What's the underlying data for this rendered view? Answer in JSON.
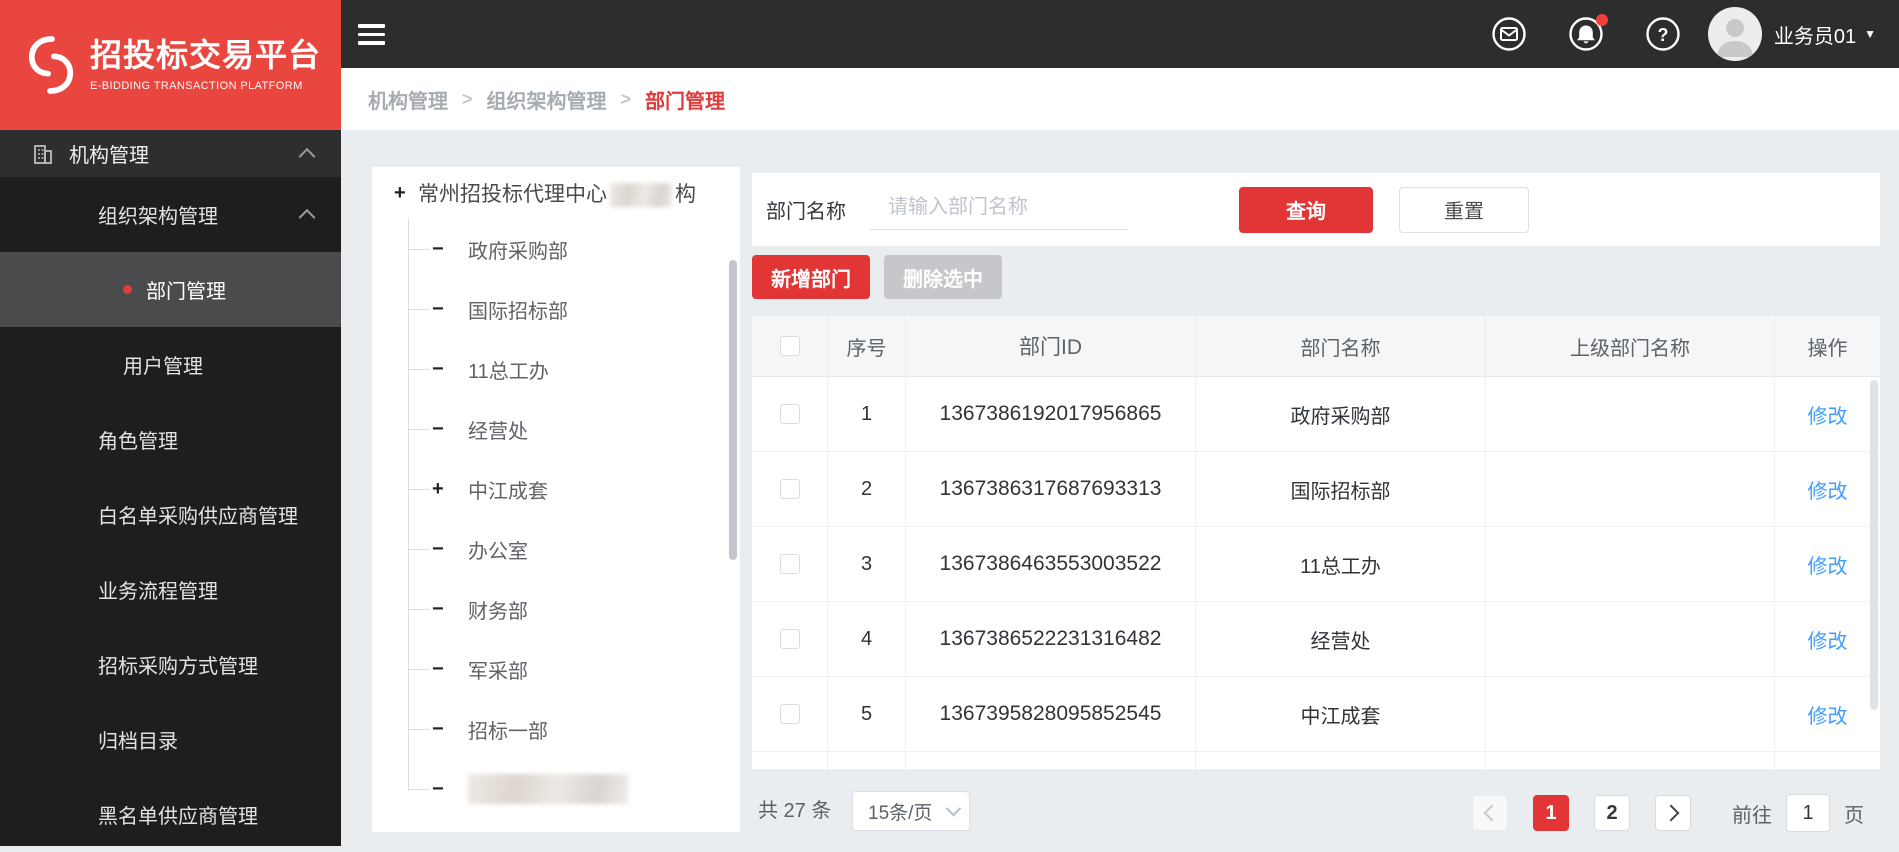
{
  "colors": {
    "accent_red": "#e23636",
    "logo_red": "#e8463f",
    "link_blue": "#409eff",
    "sidebar_bg": "#1e1e1e",
    "topbar_bg": "#2d2d2d",
    "page_bg": "#e9edf0",
    "table_header_bg": "#f4f6f8"
  },
  "brand": {
    "title": "招投标交易平台",
    "subtitle": "E-BIDDING TRANSACTION PLATFORM"
  },
  "topbar": {
    "username": "业务员01",
    "icons": {
      "mail": "mail-icon",
      "notification": "bell-icon",
      "help": "question-icon",
      "avatar": "user-avatar"
    },
    "notification_badge": true
  },
  "breadcrumb": {
    "separator": ">",
    "items": [
      "机构管理",
      "组织架构管理",
      "部门管理"
    ]
  },
  "sidebar": {
    "items": [
      {
        "label": "机构管理"
      },
      {
        "label": "组织架构管理"
      },
      {
        "label": "部门管理"
      },
      {
        "label": "用户管理"
      },
      {
        "label": "角色管理"
      },
      {
        "label": "白名单采购供应商管理"
      },
      {
        "label": "业务流程管理"
      },
      {
        "label": "招标采购方式管理"
      },
      {
        "label": "归档目录"
      },
      {
        "label": "黑名单供应商管理"
      }
    ]
  },
  "tree": {
    "root": {
      "toggle": "+",
      "label_prefix": "常州招投标代理中心",
      "label_suffix": "构",
      "redacted_middle": true
    },
    "children": [
      {
        "toggle": "−",
        "label": "政府采购部"
      },
      {
        "toggle": "−",
        "label": "国际招标部"
      },
      {
        "toggle": "−",
        "label": "11总工办"
      },
      {
        "toggle": "−",
        "label": "经营处"
      },
      {
        "toggle": "+",
        "label": "中江成套"
      },
      {
        "toggle": "−",
        "label": "办公室"
      },
      {
        "toggle": "−",
        "label": "财务部"
      },
      {
        "toggle": "−",
        "label": "军采部"
      },
      {
        "toggle": "−",
        "label": "招标一部"
      },
      {
        "toggle": "−",
        "label": "",
        "redacted": true
      }
    ]
  },
  "search": {
    "label": "部门名称",
    "placeholder": "请输入部门名称",
    "query_label": "查询",
    "reset_label": "重置"
  },
  "actions": {
    "add_label": "新增部门",
    "delete_label": "删除选中"
  },
  "table": {
    "headers": {
      "seq": "序号",
      "id": "部门ID",
      "name": "部门名称",
      "parent": "上级部门名称",
      "ops": "操作"
    },
    "row_action": "修改",
    "rows": [
      {
        "seq": "1",
        "id": "1367386192017956865",
        "name": "政府采购部",
        "parent": ""
      },
      {
        "seq": "2",
        "id": "1367386317687693313",
        "name": "国际招标部",
        "parent": ""
      },
      {
        "seq": "3",
        "id": "1367386463553003522",
        "name": "11总工办",
        "parent": ""
      },
      {
        "seq": "4",
        "id": "1367386522231316482",
        "name": "经营处",
        "parent": ""
      },
      {
        "seq": "5",
        "id": "1367395828095852545",
        "name": "中江成套",
        "parent": ""
      }
    ]
  },
  "pagination": {
    "total_label": "共 27 条",
    "page_size_label": "15条/页",
    "pages": [
      "1",
      "2"
    ],
    "active_page": "1",
    "goto_label": "前往",
    "goto_value": "1",
    "unit_label": "页"
  }
}
